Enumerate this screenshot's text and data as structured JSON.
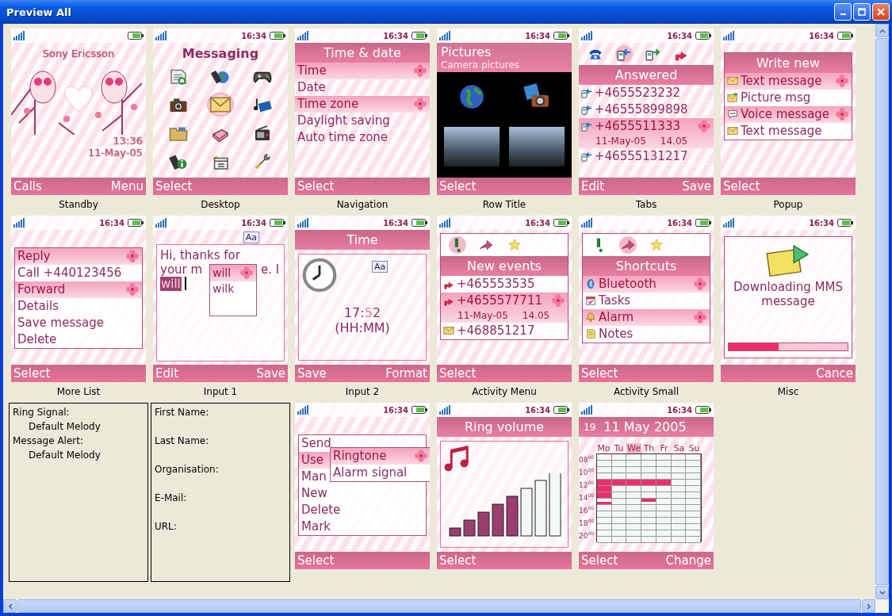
{
  "window": {
    "title": "Preview All"
  },
  "screens": [
    {
      "kind": "standby",
      "caption": "Standby",
      "brand": "Sony Ericsson",
      "clock": "13:36",
      "date": "11-May-05",
      "softkeys": {
        "left": "Calls",
        "right": "Menu"
      }
    },
    {
      "kind": "desktop",
      "caption": "Desktop",
      "time": "16:34",
      "title": "Messaging",
      "icons": [
        {
          "kind": "document",
          "selected": false
        },
        {
          "kind": "phone-globe",
          "selected": false
        },
        {
          "kind": "gamepad",
          "selected": false
        },
        {
          "kind": "camera",
          "selected": false
        },
        {
          "kind": "envelope",
          "selected": true
        },
        {
          "kind": "media",
          "selected": false
        },
        {
          "kind": "folder",
          "selected": false
        },
        {
          "kind": "book",
          "selected": false
        },
        {
          "kind": "radio",
          "selected": false
        },
        {
          "kind": "phone-info",
          "selected": false
        },
        {
          "kind": "calendar",
          "selected": false
        },
        {
          "kind": "wrench",
          "selected": false
        }
      ],
      "softkeys": {
        "left": "Select"
      }
    },
    {
      "kind": "menu",
      "caption": "Navigation",
      "time": "16:34",
      "title": "Time & date",
      "items": [
        {
          "label": "Time",
          "selected": true
        },
        {
          "label": "Date",
          "selected": false
        },
        {
          "label": "Time zone",
          "selected": true
        },
        {
          "label": "Daylight saving",
          "selected": false
        },
        {
          "label": "Auto time zone",
          "selected": false
        }
      ],
      "softkeys": {
        "left": "Select"
      }
    },
    {
      "kind": "gallery",
      "caption": "Row Title",
      "time": "16:34",
      "title": "Pictures",
      "subtitle": "Camera pictures",
      "thumbs": [
        {
          "kind": "globe"
        },
        {
          "kind": "photo-camera"
        },
        {
          "kind": "photo"
        },
        {
          "kind": "photo"
        }
      ],
      "softkeys": {
        "left": "Select"
      }
    },
    {
      "kind": "tabs",
      "caption": "Tabs",
      "time": "16:34",
      "tabs": [
        {
          "kind": "phone",
          "selected": false
        },
        {
          "kind": "incoming",
          "selected": true
        },
        {
          "kind": "outgoing",
          "selected": false
        },
        {
          "kind": "missed",
          "selected": false
        }
      ],
      "title": "Answered",
      "items": [
        {
          "kind": "incoming",
          "label": "+4655523232",
          "selected": false
        },
        {
          "kind": "incoming",
          "label": "+46555899898",
          "selected": false
        },
        {
          "kind": "incoming",
          "label": "+4655511333",
          "selected": true,
          "date": "11-May-05",
          "clock": "14.05"
        },
        {
          "kind": "incoming",
          "label": "+46555131217",
          "selected": false
        }
      ],
      "softkeys": {
        "left": "Edit",
        "right": "Save"
      }
    },
    {
      "kind": "popup",
      "caption": "Popup",
      "time": "16:34",
      "title": "Write new",
      "items": [
        {
          "kind": "message",
          "label": "Text message",
          "selected": true
        },
        {
          "kind": "picture",
          "label": "Picture msg",
          "selected": false
        },
        {
          "kind": "voice",
          "label": "Voice message",
          "selected": true
        },
        {
          "kind": "message",
          "label": "Text message",
          "selected": false
        }
      ],
      "softkeys": {
        "left": "Select"
      }
    },
    {
      "kind": "popup",
      "caption": "More List",
      "time": "16:34",
      "items": [
        {
          "label": "Reply",
          "selected": true
        },
        {
          "label": "Call +440123456",
          "selected": false
        },
        {
          "label": "Forward",
          "selected": true
        },
        {
          "label": "Details",
          "selected": false
        },
        {
          "label": "Save message",
          "selected": false
        },
        {
          "label": "Delete",
          "selected": false
        }
      ],
      "softkeys": {
        "left": "Select"
      }
    },
    {
      "kind": "input",
      "caption": "Input 1",
      "time": "16:34",
      "mode": "Aa",
      "lines": [
        {
          "parts": [
            "Hi, thanks for"
          ]
        },
        {
          "parts": [
            "your m",
            "e. I"
          ]
        }
      ],
      "word": "will",
      "suggestions": [
        {
          "label": "will",
          "selected": true
        },
        {
          "label": "wilk",
          "selected": false
        }
      ],
      "softkeys": {
        "left": "Edit",
        "right": "Save"
      }
    },
    {
      "kind": "time_input",
      "caption": "Input 2",
      "time": "16:34",
      "title": "Time",
      "mode": "Aa",
      "value": {
        "before": "17:",
        "cursor": "5",
        "after": "2"
      },
      "format": "(HH:MM)",
      "softkeys": {
        "left": "Save",
        "right": "Format"
      }
    },
    {
      "kind": "activity",
      "caption": "Activity Menu",
      "time": "16:34",
      "tabs": [
        {
          "kind": "alert",
          "selected": true
        },
        {
          "kind": "arrow",
          "selected": false
        },
        {
          "kind": "star",
          "selected": false
        }
      ],
      "title": "New events",
      "items": [
        {
          "kind": "missed",
          "label": "+465553535",
          "selected": false
        },
        {
          "kind": "missed",
          "label": "+4655577711",
          "selected": true,
          "date": "11-May-05",
          "clock": "14.05"
        },
        {
          "kind": "message",
          "label": "+468851217",
          "selected": false
        }
      ],
      "softkeys": {
        "left": "Select"
      }
    },
    {
      "kind": "activity",
      "caption": "Activity Small",
      "time": "16:34",
      "tabs": [
        {
          "kind": "alert",
          "selected": false
        },
        {
          "kind": "arrow",
          "selected": true
        },
        {
          "kind": "star",
          "selected": false
        }
      ],
      "title": "Shortcuts",
      "items": [
        {
          "kind": "bluetooth",
          "label": "Bluetooth",
          "selected": true
        },
        {
          "kind": "tasks",
          "label": "Tasks",
          "selected": false
        },
        {
          "kind": "alarm",
          "label": "Alarm",
          "selected": true
        },
        {
          "kind": "notes",
          "label": "Notes",
          "selected": false
        }
      ],
      "softkeys": {
        "left": "Select"
      }
    },
    {
      "kind": "progress",
      "caption": "Misc",
      "time": "16:34",
      "message": "Downloading MMS message",
      "level": 0.42,
      "softkeys": {
        "right": "Cance"
      }
    },
    {
      "kind": "text_panel",
      "lines": [
        {
          "label": "Ring Signal:",
          "value": "Default Melody"
        },
        {
          "label": "Message Alert:",
          "value": "Default Melody"
        }
      ]
    },
    {
      "kind": "form_panel",
      "labels": [
        "First Name:",
        "Last Name:",
        "Organisation:",
        "E-Mail:",
        "URL:"
      ]
    },
    {
      "kind": "submenu",
      "time": "16:34",
      "items": [
        {
          "label": "Send",
          "selected": false
        },
        {
          "label": "Use",
          "selected": true
        },
        {
          "label": "Man",
          "selected": false
        },
        {
          "label": "New",
          "selected": false
        },
        {
          "label": "Delete",
          "selected": false
        },
        {
          "label": "Mark",
          "selected": false
        }
      ],
      "submenu": [
        {
          "label": "Ringtone",
          "selected": true
        },
        {
          "label": "Alarm signal",
          "selected": false
        }
      ],
      "softkeys": {
        "left": "Select"
      }
    },
    {
      "kind": "volume",
      "time": "16:34",
      "title": "Ring volume",
      "level": 0.625,
      "softkeys": {
        "left": "Select"
      }
    },
    {
      "kind": "calendar",
      "time": "16:34",
      "week": "19",
      "title": "11 May 2005",
      "days": [
        {
          "label": "Mo",
          "selected": false,
          "slots": [
            false,
            false,
            false,
            false,
            false,
            false,
            false,
            false,
            true,
            true,
            true,
            true,
            true,
            true,
            false,
            true,
            false,
            false,
            false,
            false,
            false,
            false,
            false,
            false,
            false,
            false,
            false,
            false
          ]
        },
        {
          "label": "Tu",
          "selected": false,
          "slots": [
            false,
            false,
            false,
            false,
            false,
            false,
            false,
            false,
            true,
            true,
            false,
            false,
            false,
            false,
            false,
            false,
            false,
            false,
            false,
            false,
            false,
            false,
            false,
            false,
            false,
            false,
            false,
            false
          ]
        },
        {
          "label": "We",
          "selected": true,
          "slots": [
            false,
            false,
            false,
            false,
            false,
            false,
            false,
            false,
            true,
            true,
            false,
            false,
            false,
            false,
            false,
            false,
            false,
            false,
            false,
            false,
            false,
            false,
            false,
            false,
            false,
            false,
            false,
            false
          ]
        },
        {
          "label": "Th",
          "selected": false,
          "slots": [
            false,
            false,
            false,
            false,
            false,
            false,
            false,
            false,
            true,
            true,
            false,
            false,
            false,
            false,
            true,
            false,
            false,
            false,
            false,
            false,
            false,
            false,
            false,
            false,
            false,
            false,
            false,
            false
          ]
        },
        {
          "label": "Fr",
          "selected": false,
          "slots": [
            false,
            false,
            false,
            false,
            false,
            false,
            false,
            false,
            true,
            true,
            false,
            false,
            false,
            false,
            false,
            false,
            false,
            false,
            false,
            false,
            false,
            false,
            false,
            false,
            false,
            false,
            false,
            false
          ]
        },
        {
          "label": "Sa",
          "selected": false,
          "slots": [
            false,
            false,
            false,
            false,
            false,
            false,
            false,
            false,
            false,
            false,
            false,
            false,
            false,
            false,
            false,
            false,
            false,
            false,
            false,
            false,
            false,
            false,
            false,
            false,
            false,
            false,
            false,
            false
          ]
        },
        {
          "label": "Su",
          "selected": false,
          "slots": [
            false,
            false,
            false,
            false,
            false,
            false,
            false,
            false,
            false,
            false,
            false,
            false,
            false,
            false,
            false,
            false,
            false,
            false,
            false,
            false,
            false,
            false,
            false,
            false,
            false,
            false,
            false,
            false
          ]
        }
      ],
      "hours": [
        "08$^{00}$",
        "10$^{00}$",
        "12$^{00}$",
        "14$^{00}$",
        "16$^{00}$",
        "18$^{00}$",
        "20$^{00}$"
      ],
      "softkeys": {
        "left": "Select",
        "right": "Change"
      }
    }
  ]
}
